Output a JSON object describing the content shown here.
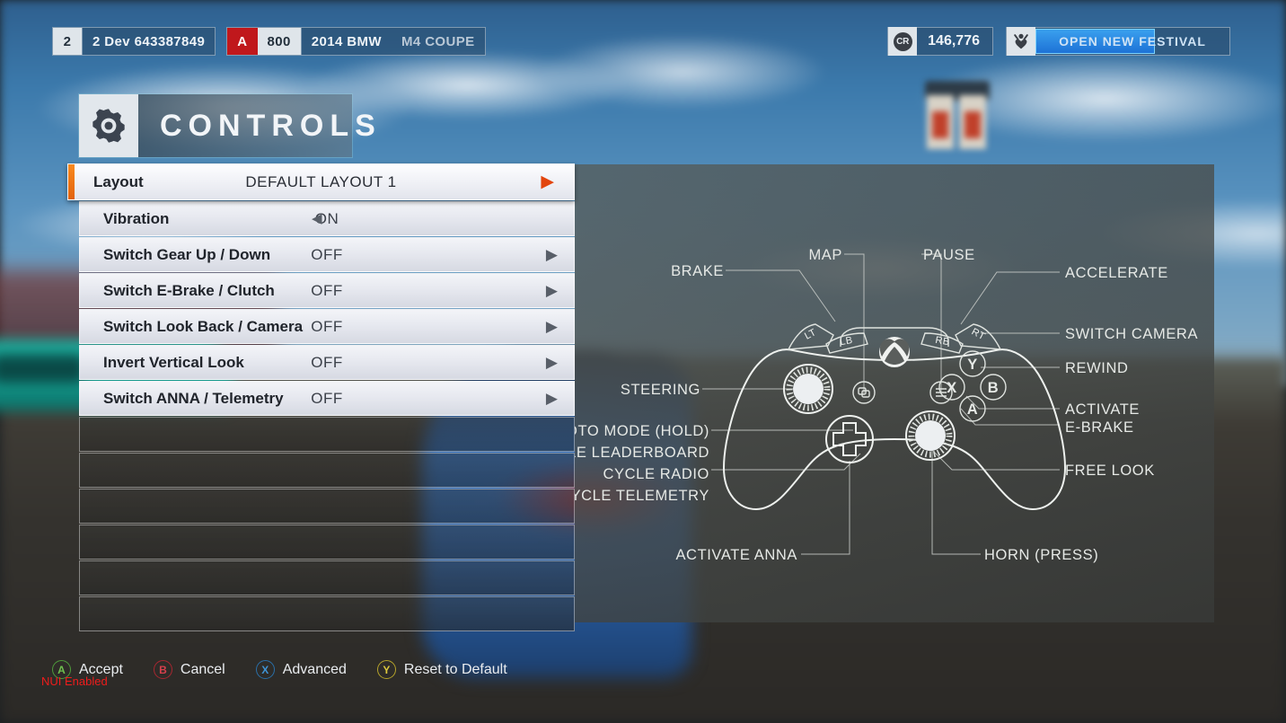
{
  "topbar": {
    "player": {
      "level": "2",
      "gamertag": "2 Dev 643387849"
    },
    "car": {
      "class_letter": "A",
      "performance_index": "800",
      "year_make": "2014 BMW",
      "model": "M4 COUPE"
    },
    "credits": {
      "icon_label": "CR",
      "amount": "146,776"
    },
    "festival": {
      "icon_name": "festival-icon",
      "label": "OPEN NEW FESTIVAL",
      "progress_percent": 61
    }
  },
  "header": {
    "icon_name": "gear-icon",
    "title": "CONTROLS"
  },
  "settings": {
    "rows": [
      {
        "label": "Layout",
        "value": "DEFAULT LAYOUT 1",
        "selected": true,
        "arrow_right": true,
        "arrow_left": false
      },
      {
        "label": "Vibration",
        "value": "ON",
        "selected": false,
        "arrow_right": false,
        "arrow_left": true
      },
      {
        "label": "Switch Gear Up / Down",
        "value": "OFF",
        "selected": false,
        "arrow_right": true,
        "arrow_left": false
      },
      {
        "label": "Switch E-Brake / Clutch",
        "value": "OFF",
        "selected": false,
        "arrow_right": true,
        "arrow_left": false
      },
      {
        "label": "Switch Look Back / Camera",
        "value": "OFF",
        "selected": false,
        "arrow_right": true,
        "arrow_left": false
      },
      {
        "label": "Invert Vertical Look",
        "value": "OFF",
        "selected": false,
        "arrow_right": true,
        "arrow_left": false
      },
      {
        "label": "Switch ANNA / Telemetry",
        "value": "OFF",
        "selected": false,
        "arrow_right": true,
        "arrow_left": false
      }
    ],
    "empty_row_count": 6,
    "arrow_right_glyph": "▶",
    "arrow_left_glyph": "◀",
    "accent_color": "#ee6a12"
  },
  "controller": {
    "shoulder_labels": {
      "lt": "LT",
      "lb": "LB",
      "rt": "RT",
      "rb": "RB"
    },
    "face_buttons": [
      {
        "name": "Y",
        "color": "#d8cf32"
      },
      {
        "name": "X",
        "color": "#2f7fd0"
      },
      {
        "name": "B",
        "color": "#c8201f"
      },
      {
        "name": "A",
        "color": "#2f9c3a"
      }
    ],
    "callouts": {
      "brake": "BRAKE",
      "steering": "STEERING",
      "map": "MAP",
      "pause": "PAUSE",
      "accelerate": "ACCELERATE",
      "switch_camera": "SWITCH CAMERA",
      "rewind": "REWIND",
      "activate": "ACTIVATE",
      "ebrake": "E-BRAKE",
      "free_look": "FREE LOOK",
      "photo_mode": "PHOTO MODE (HOLD)",
      "toggle_leaderboard": "TOGGLE LEADERBOARD",
      "cycle_radio": "CYCLE RADIO",
      "cycle_telemetry": "CYCLE TELEMETRY",
      "activate_anna": "ACTIVATE ANNA",
      "horn": "HORN (PRESS)"
    }
  },
  "prompts": [
    {
      "button": "A",
      "label": "Accept"
    },
    {
      "button": "B",
      "label": "Cancel"
    },
    {
      "button": "X",
      "label": "Advanced"
    },
    {
      "button": "Y",
      "label": "Reset to Default"
    }
  ],
  "debug": {
    "nui_text": "NUI Enabled"
  }
}
